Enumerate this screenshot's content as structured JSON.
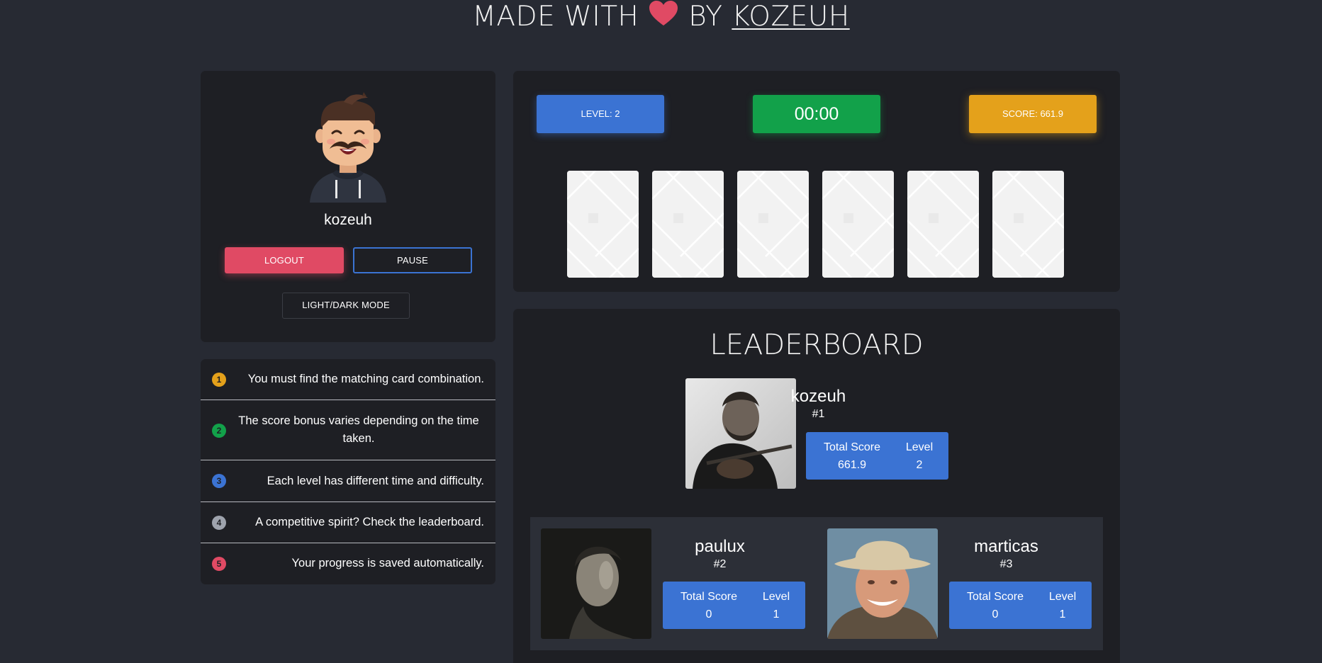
{
  "header": {
    "prefix": "MADE WITH",
    "middle": "BY",
    "author": "KOZEUH",
    "heart_color": "#e04a64"
  },
  "profile": {
    "username": "kozeuh",
    "logout_label": "LOGOUT",
    "pause_label": "PAUSE",
    "mode_label": "LIGHT/DARK MODE"
  },
  "rules": [
    {
      "num": "1",
      "text": "You must find the matching card combination.",
      "color": "#e4a11b"
    },
    {
      "num": "2",
      "text": "The score bonus varies depending on the time taken.",
      "color": "#12a14a"
    },
    {
      "num": "3",
      "text": "Each level has different time and difficulty.",
      "color": "#3b73d3"
    },
    {
      "num": "4",
      "text": "A competitive spirit? Check the leaderboard.",
      "color": "#9ea3ad"
    },
    {
      "num": "5",
      "text": "Your progress is saved automatically.",
      "color": "#e04a64"
    }
  ],
  "game": {
    "level_label": "LEVEL: 2",
    "timer": "00:00",
    "score_label": "SCORE: 661.9",
    "card_count": 6
  },
  "leaderboard": {
    "title": "LEADERBOARD",
    "players": [
      {
        "name": "kozeuh",
        "rank": "#1",
        "total_score_label": "Total Score",
        "total_score": "661.9",
        "level_label": "Level",
        "level": "2"
      },
      {
        "name": "paulux",
        "rank": "#2",
        "total_score_label": "Total Score",
        "total_score": "0",
        "level_label": "Level",
        "level": "1"
      },
      {
        "name": "marticas",
        "rank": "#3",
        "total_score_label": "Total Score",
        "total_score": "0",
        "level_label": "Level",
        "level": "1"
      }
    ]
  },
  "colors": {
    "background": "#272a33",
    "panel": "#1e1f24",
    "blue": "#3b73d3",
    "green": "#12a14a",
    "orange": "#e4a11b",
    "red": "#e04a64"
  }
}
